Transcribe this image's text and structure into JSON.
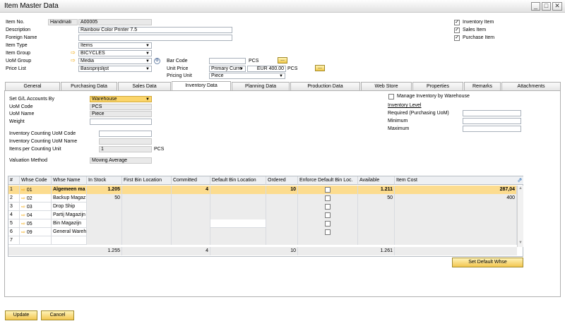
{
  "window": {
    "title": "Item Master Data"
  },
  "header": {
    "item_no_label": "Item No.",
    "item_no_series": "Handmati",
    "item_no_value": "A00005",
    "description_label": "Description",
    "description_value": "Rainbow Color Printer 7.5",
    "foreign_name_label": "Foreign Name",
    "foreign_name_value": "",
    "item_type_label": "Item Type",
    "item_type_value": "Items",
    "item_group_label": "Item Group",
    "item_group_value": "BICYCLES",
    "uom_group_label": "UoM Group",
    "uom_group_value": "Media",
    "price_list_label": "Price List",
    "price_list_value": "Basisprijslijst",
    "bar_code_label": "Bar Code",
    "bar_code_value": "",
    "bar_code_uom": "PCS",
    "unit_price_label": "Unit Price",
    "unit_price_currency": "Primary Curre",
    "unit_price_value": "EUR 400.00",
    "unit_price_uom": "PCS",
    "pricing_unit_label": "Pricing Unit",
    "pricing_unit_value": "Piece",
    "ellipsis": "...",
    "inventory_item_label": "Inventory Item",
    "sales_item_label": "Sales Item",
    "purchase_item_label": "Purchase Item",
    "check_mark": "✓"
  },
  "tabs": [
    "General",
    "Purchasing Data",
    "Sales Data",
    "Inventory Data",
    "Planning Data",
    "Production Data",
    "Web Store",
    "Properties",
    "Remarks",
    "Attachments"
  ],
  "inventory": {
    "set_gl_label": "Set G/L Accounts By",
    "set_gl_value": "Warehouse",
    "uom_code_label": "UoM Code",
    "uom_code_value": "PCS",
    "uom_name_label": "UoM Name",
    "uom_name_value": "Piece",
    "weight_label": "Weight",
    "weight_value": "",
    "count_uom_code_label": "Inventory Counting UoM Code",
    "count_uom_code_value": "",
    "count_uom_name_label": "Inventory Counting UoM Name",
    "count_uom_name_value": "",
    "items_per_count_label": "Items per Counting Unit",
    "items_per_count_value": "1",
    "items_per_count_uom": "PCS",
    "valuation_label": "Valuation Method",
    "valuation_value": "Moving Average",
    "manage_by_whse_label": "Manage Inventory by Warehouse",
    "inventory_level_label": "Inventory Level",
    "required_label": "Required (Purchasing UoM)",
    "minimum_label": "Minimum",
    "maximum_label": "Maximum"
  },
  "grid": {
    "columns": [
      "#",
      "Whse Code",
      "Whse Name",
      "In Stock",
      "First Bin Location",
      "Committed",
      "Default Bin Location",
      "Ordered",
      "Enforce Default Bin Loc.",
      "Available",
      "Item Cost"
    ],
    "rows": [
      {
        "n": "1",
        "code": "01",
        "name": "Algemeen ma",
        "stock": "1.205",
        "committed": "4",
        "ordered": "10",
        "available": "1.211",
        "cost": "287,04"
      },
      {
        "n": "2",
        "code": "02",
        "name": "Backup Magaz",
        "stock": "50",
        "committed": "",
        "ordered": "",
        "available": "50",
        "cost": "400"
      },
      {
        "n": "3",
        "code": "03",
        "name": "Drop Ship",
        "stock": "",
        "committed": "",
        "ordered": "",
        "available": "",
        "cost": ""
      },
      {
        "n": "4",
        "code": "04",
        "name": "Partij Magazijn",
        "stock": "",
        "committed": "",
        "ordered": "",
        "available": "",
        "cost": ""
      },
      {
        "n": "5",
        "code": "05",
        "name": "Bin Magazijn",
        "stock": "",
        "committed": "",
        "ordered": "",
        "available": "",
        "cost": ""
      },
      {
        "n": "6",
        "code": "09",
        "name": "General Wareh",
        "stock": "",
        "committed": "",
        "ordered": "",
        "available": "",
        "cost": ""
      },
      {
        "n": "7",
        "code": "",
        "name": "",
        "stock": "",
        "committed": "",
        "ordered": "",
        "available": "",
        "cost": ""
      }
    ],
    "totals": {
      "stock": "1.255",
      "committed": "4",
      "ordered": "10",
      "available": "1.261"
    }
  },
  "buttons": {
    "set_default": "Set Default Whse",
    "update": "Update",
    "cancel": "Cancel"
  },
  "colors": {
    "accent": "#f3c650",
    "selected_row": "#fcdc8f",
    "arrow": "#f2a400"
  }
}
